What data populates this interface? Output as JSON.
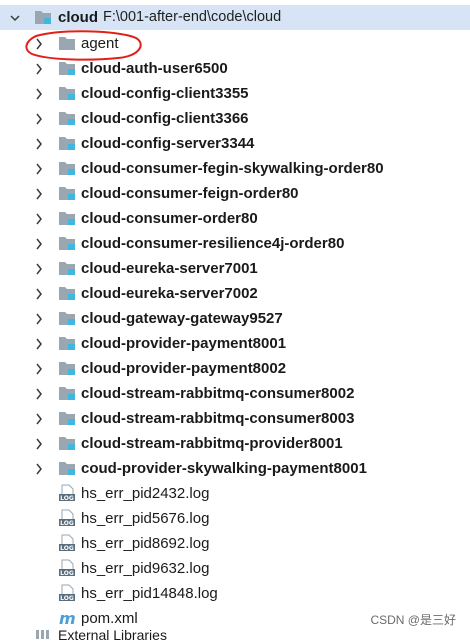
{
  "root": {
    "name": "cloud",
    "path": "F:\\001-after-end\\code\\cloud"
  },
  "folders": [
    {
      "name": "agent",
      "module": false
    },
    {
      "name": "cloud-auth-user6500",
      "module": true
    },
    {
      "name": "cloud-config-client3355",
      "module": true
    },
    {
      "name": "cloud-config-client3366",
      "module": true
    },
    {
      "name": "cloud-config-server3344",
      "module": true
    },
    {
      "name": "cloud-consumer-fegin-skywalking-order80",
      "module": true
    },
    {
      "name": "cloud-consumer-feign-order80",
      "module": true
    },
    {
      "name": "cloud-consumer-order80",
      "module": true
    },
    {
      "name": "cloud-consumer-resilience4j-order80",
      "module": true
    },
    {
      "name": "cloud-eureka-server7001",
      "module": true
    },
    {
      "name": "cloud-eureka-server7002",
      "module": true
    },
    {
      "name": "cloud-gateway-gateway9527",
      "module": true
    },
    {
      "name": "cloud-provider-payment8001",
      "module": true
    },
    {
      "name": "cloud-provider-payment8002",
      "module": true
    },
    {
      "name": "cloud-stream-rabbitmq-consumer8002",
      "module": true
    },
    {
      "name": "cloud-stream-rabbitmq-consumer8003",
      "module": true
    },
    {
      "name": "cloud-stream-rabbitmq-provider8001",
      "module": true
    },
    {
      "name": "coud-provider-skywalking-payment8001",
      "module": true
    }
  ],
  "files": [
    {
      "name": "hs_err_pid2432.log",
      "type": "log"
    },
    {
      "name": "hs_err_pid5676.log",
      "type": "log"
    },
    {
      "name": "hs_err_pid8692.log",
      "type": "log"
    },
    {
      "name": "hs_err_pid9632.log",
      "type": "log"
    },
    {
      "name": "hs_err_pid14848.log",
      "type": "log"
    },
    {
      "name": "pom.xml",
      "type": "maven"
    }
  ],
  "external_libraries": "External Libraries",
  "watermark": "CSDN @是三好",
  "colors": {
    "selection": "#d6e4f5",
    "folder": "#9aa7b0",
    "module_marker": "#40b6e0",
    "annotation": "#e0201a"
  }
}
